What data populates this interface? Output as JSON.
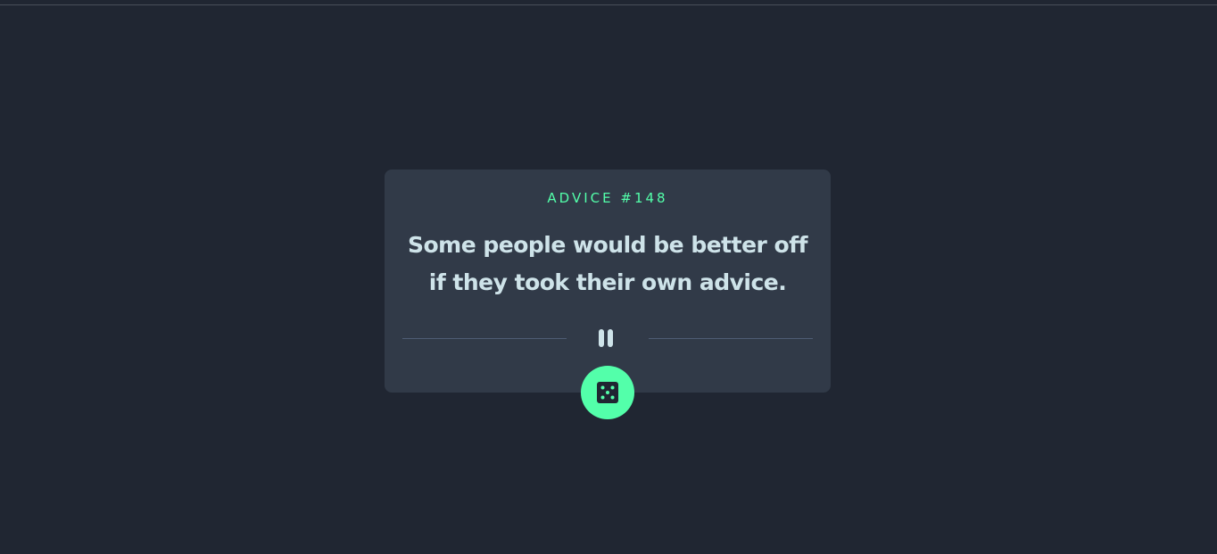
{
  "advice": {
    "label": "ADVICE #148",
    "text": "Some people would be better off if they took their own advice."
  },
  "icons": {
    "divider": "pause-icon",
    "button": "dice-icon"
  },
  "colors": {
    "background": "#202632",
    "card": "#313a48",
    "accent": "#53ffaa",
    "text": "#cee3e9",
    "divider": "#4f5d74"
  }
}
